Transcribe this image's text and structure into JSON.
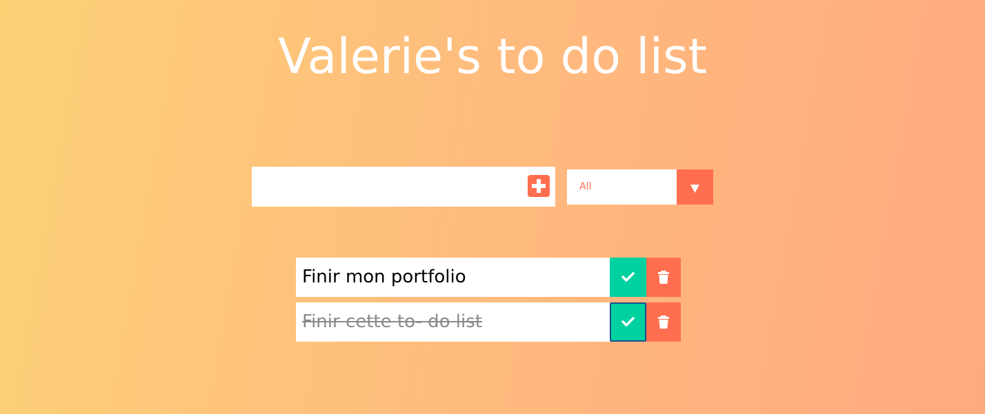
{
  "header": {
    "title": "Valerie's to do list"
  },
  "form": {
    "input_value": "",
    "input_placeholder": "",
    "add_icon": "plus-square-icon"
  },
  "filter": {
    "selected": "All",
    "arrow_icon": "triangle-down-icon"
  },
  "todos": [
    {
      "text": "Finir mon portfolio",
      "completed": false
    },
    {
      "text": "Finir cette to- do list",
      "completed": true
    }
  ],
  "icons": {
    "complete": "check-icon",
    "delete": "trash-icon"
  },
  "colors": {
    "accent": "#ff6f4f",
    "complete": "#00d1a1",
    "gradient_start": "#fcd176",
    "gradient_end": "#ffa97f"
  }
}
